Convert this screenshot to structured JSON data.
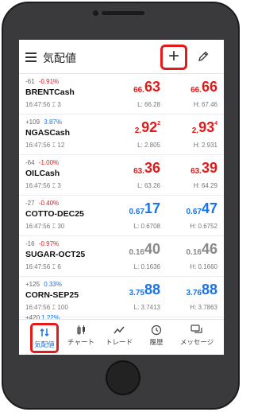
{
  "header": {
    "title": "気配値",
    "add_label": "+"
  },
  "rows": [
    {
      "change": "-61",
      "percent": "-0.91%",
      "dir": "neg",
      "symbol": "BRENTCash",
      "time": "16:47:56",
      "spread": "3",
      "bid": {
        "small": "66.",
        "big": "63",
        "sup": "",
        "color": "red"
      },
      "ask": {
        "small": "66.",
        "big": "66",
        "sup": "",
        "color": "red"
      },
      "low": "L: 66.28",
      "high": "H: 67.46"
    },
    {
      "change": "+109",
      "percent": "3.87%",
      "dir": "pos",
      "symbol": "NGASCash",
      "time": "16:47:56",
      "spread": "12",
      "bid": {
        "small": "2.",
        "big": "92",
        "sup": "2",
        "color": "red"
      },
      "ask": {
        "small": "2.",
        "big": "93",
        "sup": "4",
        "color": "red"
      },
      "low": "L: 2.805",
      "high": "H: 2.931"
    },
    {
      "change": "-64",
      "percent": "-1.00%",
      "dir": "neg",
      "symbol": "OILCash",
      "time": "16:47:56",
      "spread": "3",
      "bid": {
        "small": "63.",
        "big": "36",
        "sup": "",
        "color": "red"
      },
      "ask": {
        "small": "63.",
        "big": "39",
        "sup": "",
        "color": "red"
      },
      "low": "L: 63.26",
      "high": "H: 64.29"
    },
    {
      "change": "-27",
      "percent": "-0.40%",
      "dir": "neg",
      "symbol": "COTTO-DEC25",
      "time": "16:47:56",
      "spread": "30",
      "bid": {
        "small": "0.67",
        "big": "17",
        "sup": "",
        "color": "blue"
      },
      "ask": {
        "small": "0.67",
        "big": "47",
        "sup": "",
        "color": "blue"
      },
      "low": "L: 0.6708",
      "high": "H: 0.6752"
    },
    {
      "change": "-16",
      "percent": "-0.97%",
      "dir": "neg",
      "symbol": "SUGAR-OCT25",
      "time": "16:47:56",
      "spread": "6",
      "bid": {
        "small": "0.16",
        "big": "40",
        "sup": "",
        "color": "gray"
      },
      "ask": {
        "small": "0.16",
        "big": "46",
        "sup": "",
        "color": "gray"
      },
      "low": "L: 0.1636",
      "high": "H: 0.1660"
    },
    {
      "change": "+125",
      "percent": "0.33%",
      "dir": "pos",
      "symbol": "CORN-SEP25",
      "time": "16:47:56",
      "spread": "100",
      "bid": {
        "small": "3.75",
        "big": "88",
        "sup": "",
        "color": "blue"
      },
      "ask": {
        "small": "3.76",
        "big": "88",
        "sup": "",
        "color": "blue"
      },
      "low": "L: 3.7413",
      "high": "H: 3.7863"
    }
  ],
  "partial_row": {
    "change": "+420",
    "percent": "1.22%"
  },
  "nav": [
    {
      "label": "気配値",
      "icon": "quotes-icon",
      "active": true
    },
    {
      "label": "チャート",
      "icon": "chart-icon",
      "active": false
    },
    {
      "label": "トレード",
      "icon": "trade-icon",
      "active": false
    },
    {
      "label": "履歴",
      "icon": "history-icon",
      "active": false
    },
    {
      "label": "メッセージ",
      "icon": "messages-icon",
      "active": false
    }
  ],
  "colors": {
    "negative": "#e31a1a",
    "positive": "#1a73e8",
    "highlight": "#e31a1a"
  }
}
